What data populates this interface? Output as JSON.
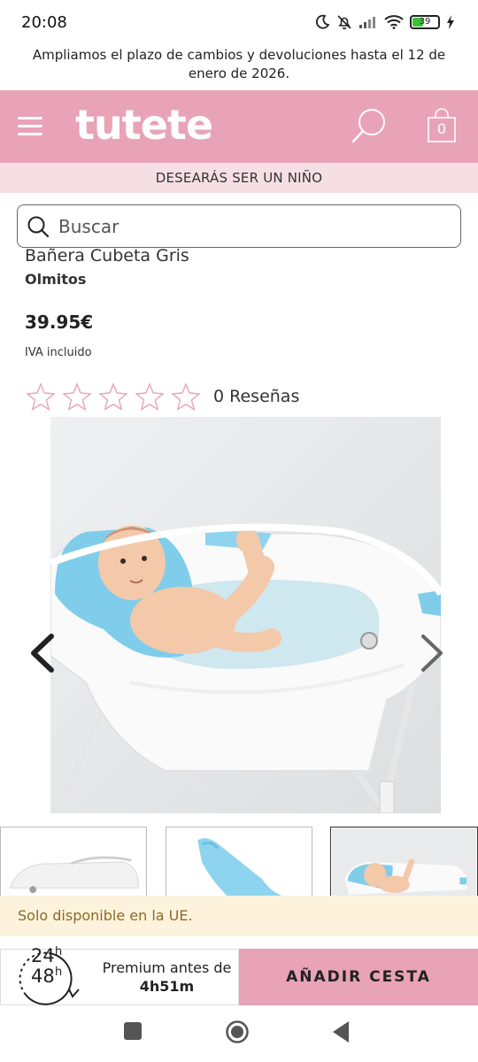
{
  "status_bar": {
    "time": "20:08",
    "battery": "39",
    "icons": [
      "moon-icon",
      "bell-off-icon",
      "signal-icon",
      "wifi-icon",
      "battery-icon",
      "charging-icon"
    ]
  },
  "notice": "Ampliamos el plazo de cambios y devoluciones hasta el 12 de enero de 2026.",
  "header": {
    "logo": "tutete",
    "cart_count": "0",
    "background": "#e8a3b6"
  },
  "promo": "DESEARÁS SER UN NIÑO",
  "search": {
    "placeholder": "Buscar"
  },
  "product": {
    "title": "Bañera Cubeta Gris",
    "brand": "Olmitos",
    "price": "39.95€",
    "tax_note": "IVA incluido",
    "rating_stars": 0,
    "rating_max": 5,
    "reviews": "0 Reseñas"
  },
  "eu_notice": "Solo disponible en la UE.",
  "bottom": {
    "badge_24": "24",
    "badge_48": "48",
    "badge_unit": "h",
    "premium_label": "Premium antes de",
    "premium_time": "4h51m",
    "add_to_cart": "AÑADIR CESTA"
  },
  "colors": {
    "accent_pink": "#e8a3b6",
    "promo_bg": "#f6dfe4",
    "eu_bg": "#fdf3dc",
    "eu_text": "#8a6a28",
    "star_outline": "#e8a3b6"
  }
}
